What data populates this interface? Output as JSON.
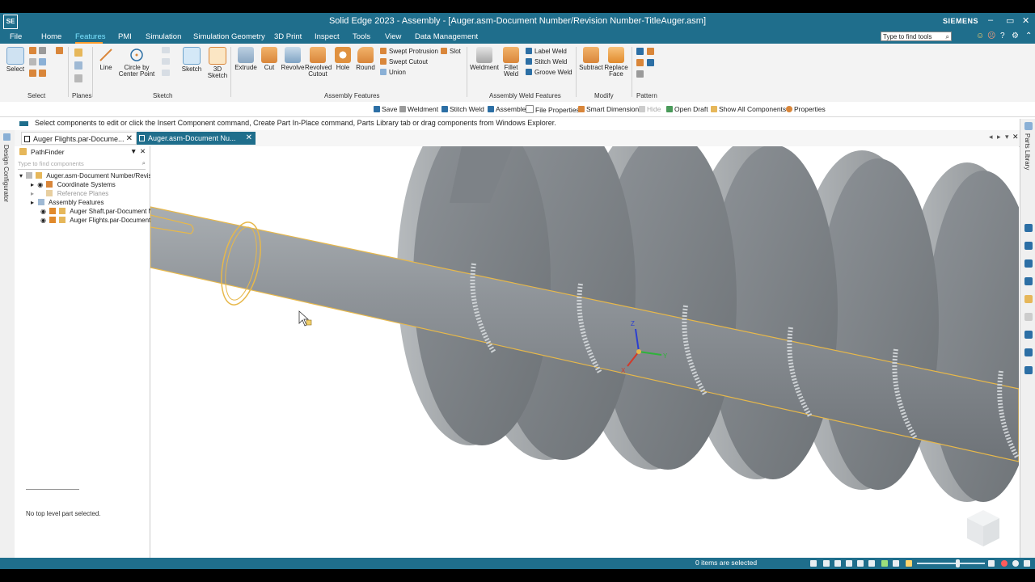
{
  "app": {
    "logo": "SE",
    "title": "Solid Edge 2023 - Assembly - [Auger.asm-Document Number/Revision Number-TitleAuger.asm]",
    "brand": "SIEMENS",
    "window_controls": [
      "–",
      "▭",
      "✕"
    ]
  },
  "menu": {
    "items": [
      "File",
      "Home",
      "Features",
      "PMI",
      "Simulation",
      "Simulation Geometry",
      "3D Print",
      "Inspect",
      "Tools",
      "View",
      "Data Management"
    ],
    "active": "Features",
    "search_placeholder": "Type to find tools"
  },
  "ribbon": {
    "select": {
      "label": "Select",
      "group": "Select"
    },
    "planes": {
      "group": "Planes"
    },
    "sketch_group": {
      "line": "Line",
      "circle": "Circle by Center Point",
      "sketch": "Sketch",
      "sketch3d": "3D Sketch",
      "group": "Sketch"
    },
    "assembly_features": {
      "extrude": "Extrude",
      "cut": "Cut",
      "revolve": "Revolve",
      "revolved_cutout": "Revolved Cutout",
      "hole": "Hole",
      "round": "Round",
      "swept_protrusion": "Swept Protrusion",
      "slot": "Slot",
      "swept_cutout": "Swept Cutout",
      "union": "Union",
      "group": "Assembly Features"
    },
    "weld_features": {
      "weldment": "Weldment",
      "fillet_weld": "Fillet Weld",
      "label_weld": "Label Weld",
      "stitch_weld": "Stitch Weld",
      "groove_weld": "Groove Weld",
      "group": "Assembly Weld Features"
    },
    "modify": {
      "subtract": "Subtract",
      "replace_face": "Replace Face",
      "group": "Modify"
    },
    "pattern": {
      "group": "Pattern"
    }
  },
  "command_bar": {
    "save": "Save",
    "weldment": "Weldment",
    "stitch_weld": "Stitch Weld",
    "assemble": "Assemble",
    "file_properties": "File Properties",
    "smart_dimension": "Smart Dimension",
    "hide": "Hide",
    "open_draft": "Open Draft",
    "show_all": "Show All Components",
    "properties": "Properties"
  },
  "prompt": "Select components to edit or click the Insert Component command, Create Part In-Place command, Parts Library tab or drag components from Windows Explorer.",
  "tabs": [
    {
      "label": "Auger Flights.par-Docume...",
      "active": false
    },
    {
      "label": "Auger.asm-Document Nu...",
      "active": true
    }
  ],
  "left_strip": {
    "label": "Design Configurator"
  },
  "right_strip": {
    "label": "Parts Library"
  },
  "pathfinder": {
    "title": "PathFinder",
    "search_placeholder": "Type to find components",
    "root": "Auger.asm-Document Number/Revis",
    "items": [
      {
        "label": "Coordinate Systems"
      },
      {
        "label": "Reference Planes"
      },
      {
        "label": "Assembly Features"
      },
      {
        "label": "Auger Shaft.par-Document N"
      },
      {
        "label": "Auger Flights.par-Document"
      }
    ],
    "footer": "No top level part selected."
  },
  "triad": {
    "x": "X",
    "y": "Y",
    "z": "Z"
  },
  "status": {
    "text": "0 items are selected"
  },
  "colors": {
    "titlebar": "#1f6e8c",
    "accent": "#ff9c2e",
    "selection": "#e7b84a",
    "part": "#8f9499"
  }
}
